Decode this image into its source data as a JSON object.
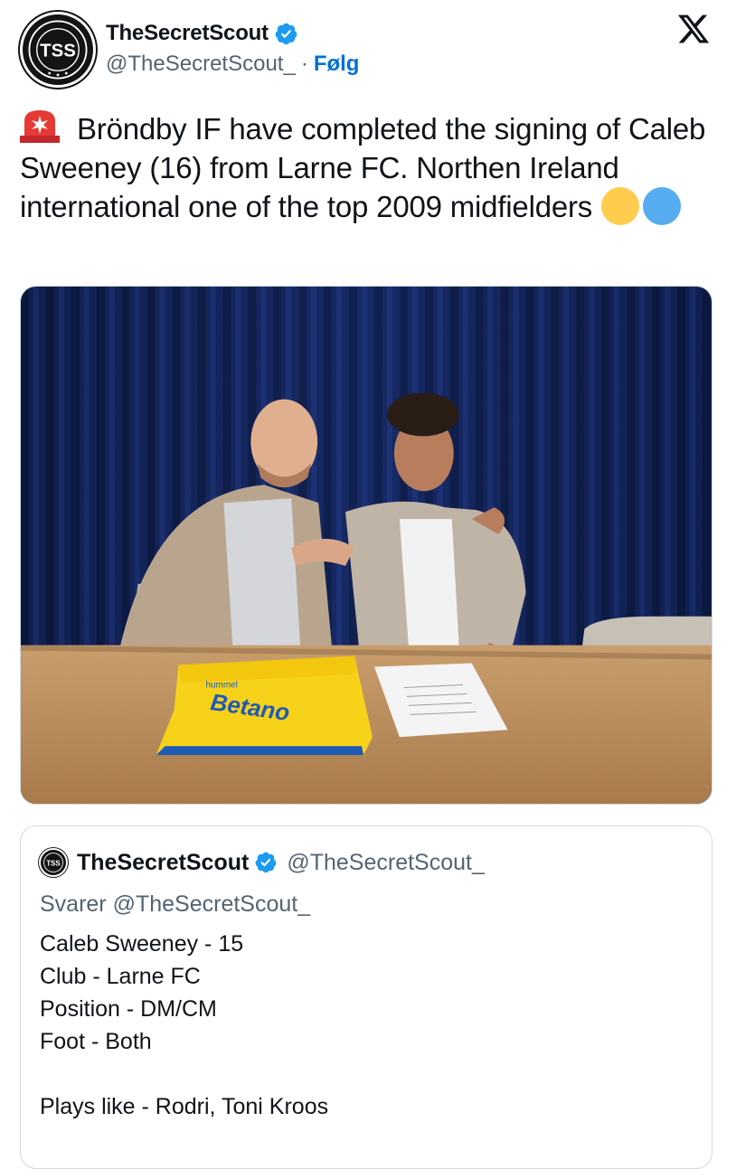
{
  "author": {
    "display_name": "TheSecretScout",
    "handle": "@TheSecretScout_",
    "separator": "·",
    "follow_label": "Følg",
    "avatar_text": "TSS"
  },
  "tweet": {
    "text": " Bröndby IF have completed the signing of Caleb Sweeney (16)  from Larne FC.  Northen Ireland international one of the top 2009 midfielders"
  },
  "photo": {
    "jersey_sponsor": "Betano",
    "jersey_brand": "hummel"
  },
  "quoted_tweet": {
    "display_name": "TheSecretScout",
    "handle": "@TheSecretScout_",
    "reply_to": "Svarer @TheSecretScout_",
    "lines": [
      "Caleb Sweeney - 15",
      "Club - Larne FC",
      "Position - DM/CM",
      "Foot - Both",
      "",
      "Plays like - Rodri, Toni Kroos"
    ]
  },
  "icons": {
    "verified": "verified-badge-icon",
    "logo": "x-logo-icon",
    "siren": "siren-emoji-icon",
    "yellow_circle": "yellow-circle-emoji",
    "blue_circle": "blue-circle-emoji"
  },
  "colors": {
    "verified": "#1d9bf0",
    "follow": "#006fd6",
    "secondary_text": "#536471",
    "border": "#cfd9de"
  }
}
